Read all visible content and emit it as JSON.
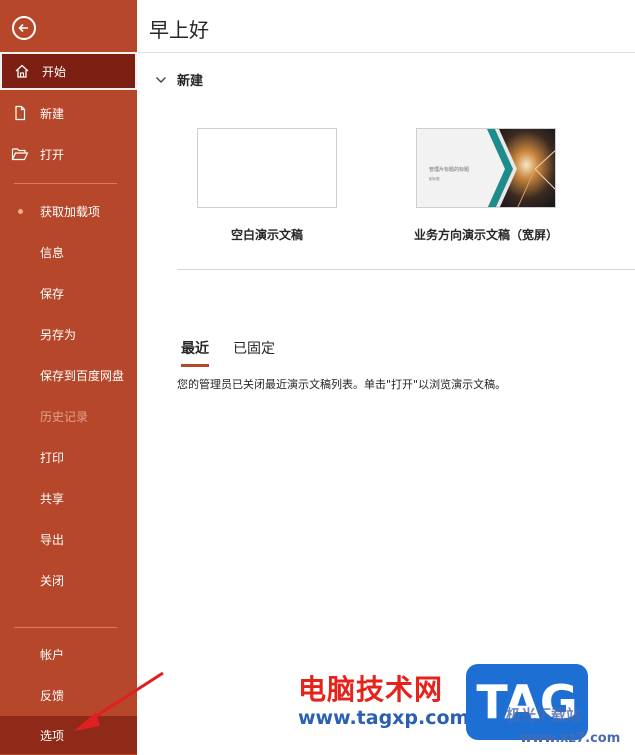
{
  "sidebar": {
    "items": [
      {
        "label": "开始",
        "icon": "home-icon"
      },
      {
        "label": "新建",
        "icon": "new-file-icon"
      },
      {
        "label": "打开",
        "icon": "open-folder-icon"
      },
      {
        "label": "获取加载项",
        "icon": "dot-icon"
      },
      {
        "label": "信息"
      },
      {
        "label": "保存"
      },
      {
        "label": "另存为"
      },
      {
        "label": "保存到百度网盘"
      },
      {
        "label": "历史记录"
      },
      {
        "label": "打印"
      },
      {
        "label": "共享"
      },
      {
        "label": "导出"
      },
      {
        "label": "关闭"
      },
      {
        "label": "帐户"
      },
      {
        "label": "反馈"
      },
      {
        "label": "选项"
      }
    ],
    "accent": "#b7472a"
  },
  "main": {
    "greeting": "早上好",
    "new_section": {
      "title": "新建",
      "templates": [
        {
          "label": "空白演示文稿"
        },
        {
          "label": "业务方向演示文稿（宽屏）",
          "thumb_title": "管理片标题的标题",
          "thumb_sub": "副标题"
        }
      ]
    },
    "tabs": [
      "最近",
      "已固定"
    ],
    "message": "您的管理员已关闭最近演示文稿列表。单击\"打开\"以浏览演示文稿。"
  },
  "watermark": {
    "cn": "电脑技术网",
    "url": "www.tagxp.com",
    "logo": "TAG",
    "logo_sub": "极光下载站",
    "logo_url": "www.xz7.com"
  }
}
